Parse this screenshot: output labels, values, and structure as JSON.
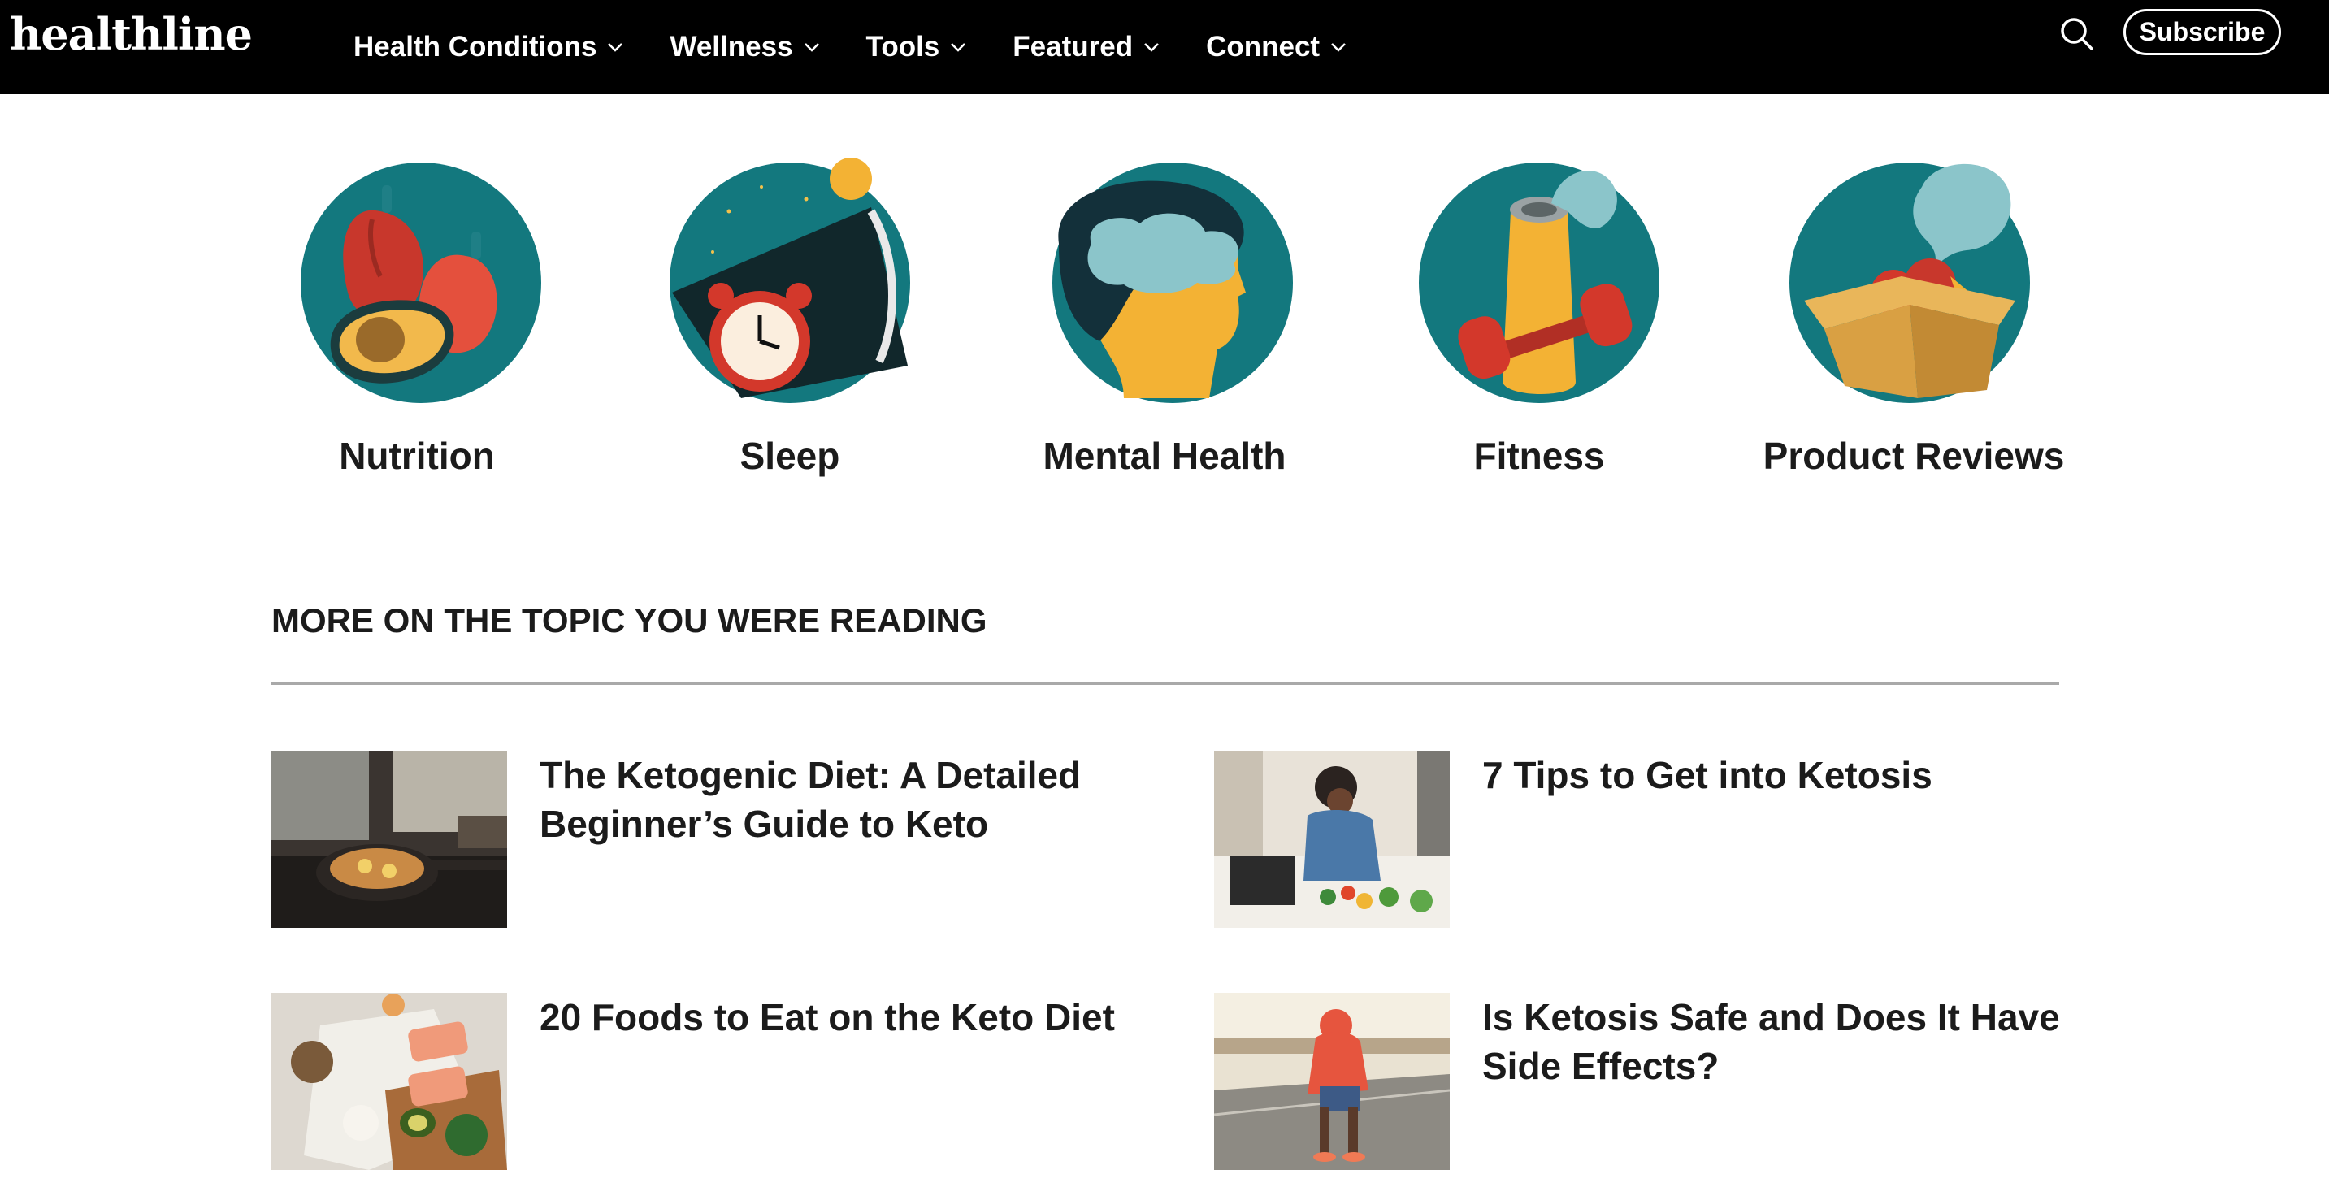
{
  "header": {
    "logo": "healthline",
    "nav": [
      {
        "label": "Health Conditions"
      },
      {
        "label": "Wellness"
      },
      {
        "label": "Tools"
      },
      {
        "label": "Featured"
      },
      {
        "label": "Connect"
      }
    ],
    "search_icon": "search-icon",
    "subscribe_label": "Subscribe"
  },
  "topics": [
    {
      "label": "Nutrition",
      "icon": "nutrition-icon"
    },
    {
      "label": "Sleep",
      "icon": "sleep-icon"
    },
    {
      "label": "Mental Health",
      "icon": "mental-health-icon"
    },
    {
      "label": "Fitness",
      "icon": "fitness-icon"
    },
    {
      "label": "Product Reviews",
      "icon": "product-reviews-icon"
    }
  ],
  "related": {
    "heading": "MORE ON THE TOPIC YOU WERE READING",
    "articles": [
      {
        "title": "The Ketogenic Diet: A Detailed Beginner’s Guide to Keto"
      },
      {
        "title": "7 Tips to Get into Ketosis"
      },
      {
        "title": "20 Foods to Eat on the Keto Diet"
      },
      {
        "title": "Is Ketosis Safe and Does It Have Side Effects?"
      }
    ]
  },
  "colors": {
    "header_bg": "#000000",
    "teal": "#13787e",
    "accent_red": "#d63b2f",
    "accent_yellow": "#f6b93b"
  }
}
